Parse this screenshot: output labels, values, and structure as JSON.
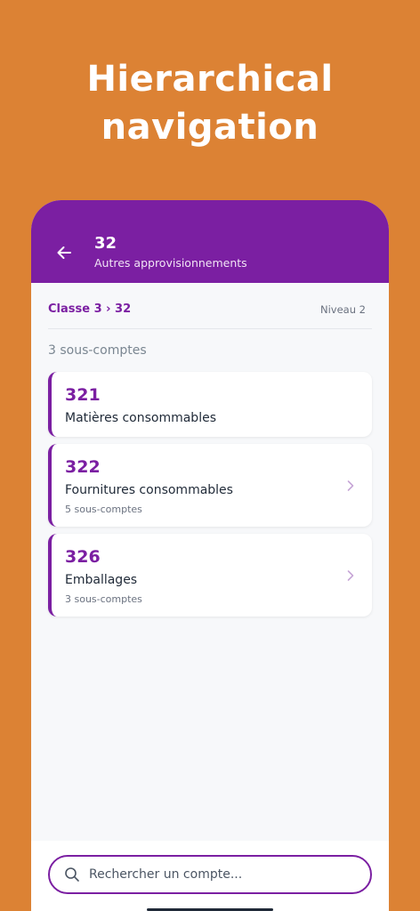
{
  "promo": {
    "title_line1": "Hierarchical",
    "title_line2": "navigation"
  },
  "appbar": {
    "back_icon": "arrow-left-icon",
    "title": "32",
    "subtitle": "Autres approvisionnements"
  },
  "breadcrumb": {
    "path": "Classe 3 › 32",
    "level": "Niveau 2"
  },
  "list": {
    "count_label": "3 sous-comptes",
    "items": [
      {
        "code": "321",
        "name": "Matières consommables",
        "sub": ""
      },
      {
        "code": "322",
        "name": "Fournitures consommables",
        "sub": "5 sous-comptes"
      },
      {
        "code": "326",
        "name": "Emballages",
        "sub": "3 sous-comptes"
      }
    ]
  },
  "search": {
    "icon": "search-icon",
    "placeholder": "Rechercher un compte...",
    "value": ""
  },
  "colors": {
    "background": "#DC8234",
    "primary": "#7B1FA2",
    "surface": "#F7F8FA",
    "card": "#FFFFFF"
  }
}
